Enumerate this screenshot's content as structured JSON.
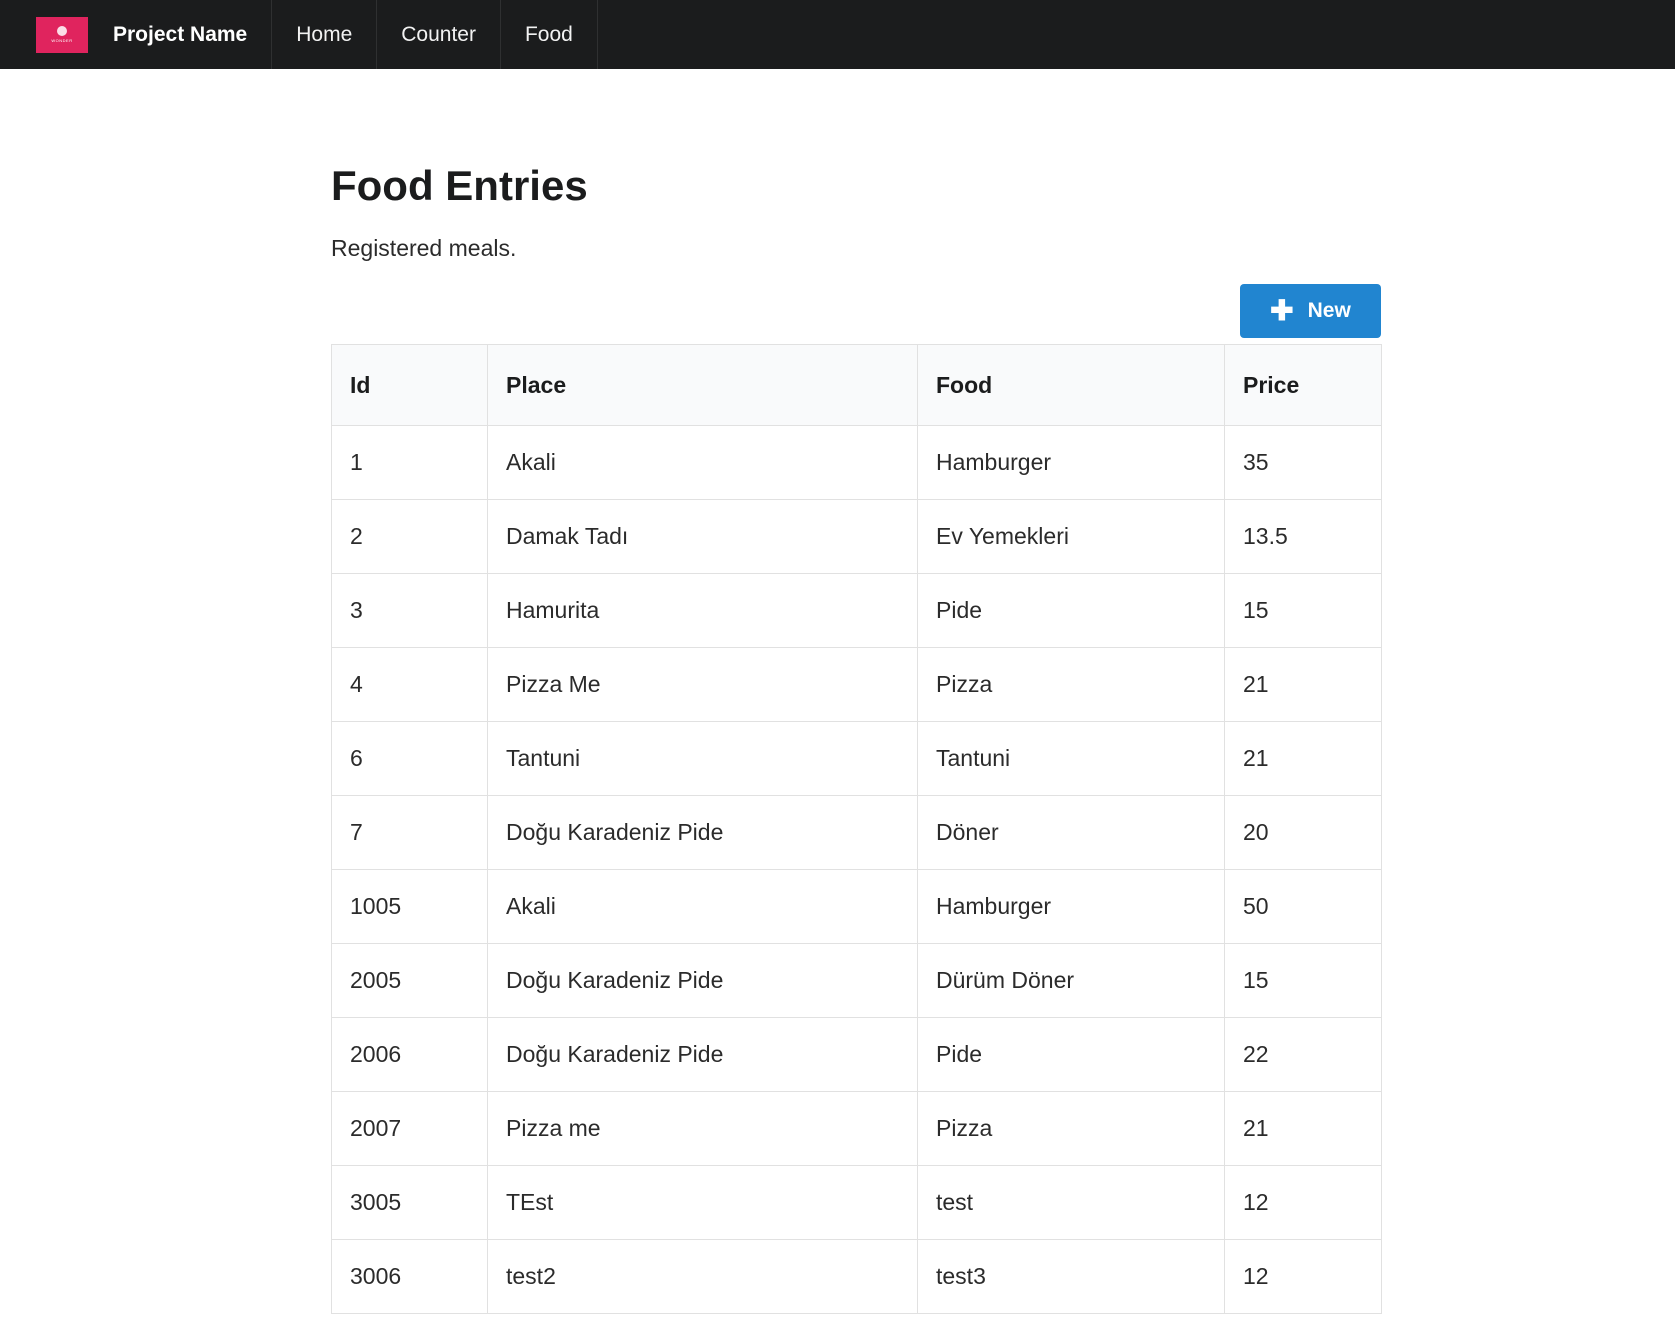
{
  "navbar": {
    "logo_text": "WONDER",
    "brand": "Project Name",
    "items": [
      {
        "label": "Home"
      },
      {
        "label": "Counter"
      },
      {
        "label": "Food"
      }
    ]
  },
  "page": {
    "title": "Food Entries",
    "subtitle": "Registered meals.",
    "new_button_label": "New"
  },
  "table": {
    "headers": [
      "Id",
      "Place",
      "Food",
      "Price"
    ],
    "rows": [
      [
        "1",
        "Akali",
        "Hamburger",
        "35"
      ],
      [
        "2",
        "Damak Tadı",
        "Ev Yemekleri",
        "13.5"
      ],
      [
        "3",
        "Hamurita",
        "Pide",
        "15"
      ],
      [
        "4",
        "Pizza Me",
        "Pizza",
        "21"
      ],
      [
        "6",
        "Tantuni",
        "Tantuni",
        "21"
      ],
      [
        "7",
        "Doğu Karadeniz Pide",
        "Döner",
        "20"
      ],
      [
        "1005",
        "Akali",
        "Hamburger",
        "50"
      ],
      [
        "2005",
        "Doğu Karadeniz Pide",
        "Dürüm Döner",
        "15"
      ],
      [
        "2006",
        "Doğu Karadeniz Pide",
        "Pide",
        "22"
      ],
      [
        "2007",
        "Pizza me",
        "Pizza",
        "21"
      ],
      [
        "3005",
        "TEst",
        "test",
        "12"
      ],
      [
        "3006",
        "test2",
        "test3",
        "12"
      ]
    ]
  },
  "colors": {
    "navbar_bg": "#1b1c1d",
    "logo_bg": "#e0245e",
    "primary_button": "#2185d0"
  },
  "icons": {
    "logo": "wonder-logo-icon",
    "new_button": "plus-icon"
  }
}
